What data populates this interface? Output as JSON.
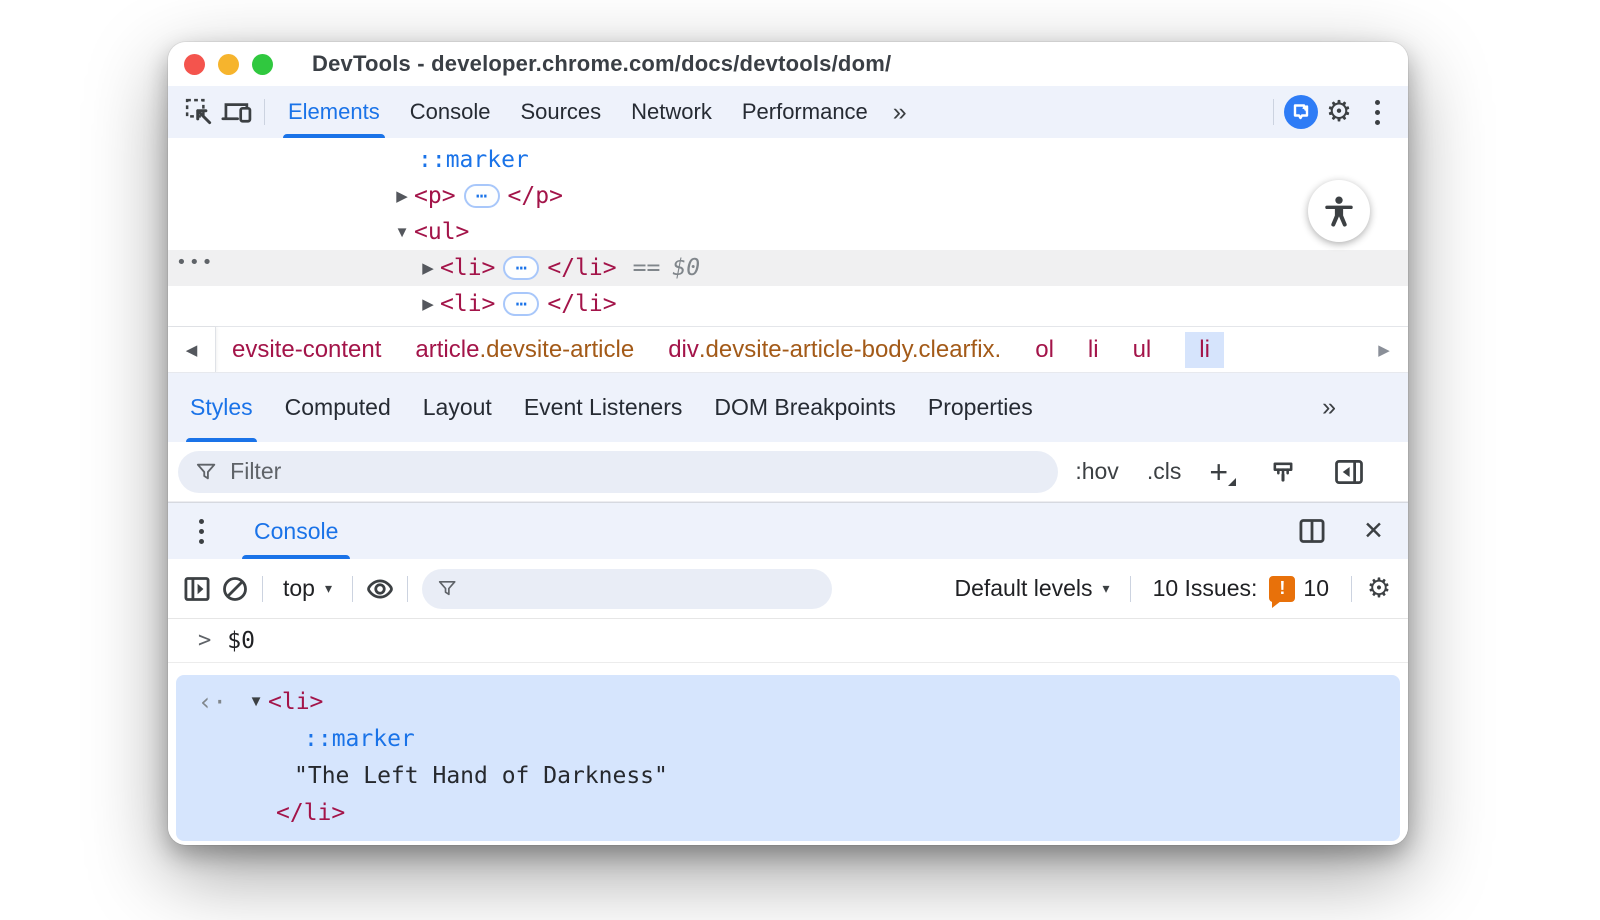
{
  "colors": {
    "accent": "#1a73e8",
    "tag": "#a31449",
    "cls": "#a35a18",
    "issues": "#e8710a",
    "selection": "#d6e5fd",
    "crumb_sel": "#d6e4fc",
    "toolbar_bg": "#eef2fb",
    "ai_blue": "#2e7cf6",
    "traffic_red": "#f4544d",
    "traffic_yellow": "#f6b42d",
    "traffic_green": "#30c83f"
  },
  "window": {
    "title": "DevTools - developer.chrome.com/docs/devtools/dom/"
  },
  "main_tabs": {
    "elements": "Elements",
    "console": "Console",
    "sources": "Sources",
    "network": "Network",
    "performance": "Performance",
    "more": "»"
  },
  "tree": {
    "gutter_dots": "•••",
    "marker": "::marker",
    "p_open": "<p>",
    "p_close": "</p>",
    "ul_open": "<ul>",
    "li_open": "<li>",
    "li_close": "</li>",
    "ellipsis": "⋯",
    "eq": "==",
    "stored_ref": "$0",
    "arrow_right": "▶",
    "arrow_down": "▼"
  },
  "breadcrumb": {
    "back": "◀",
    "forward": "▶",
    "items": [
      {
        "tag": "evsite-content",
        "cls": ""
      },
      {
        "tag": "article",
        "cls": ".devsite-article"
      },
      {
        "tag": "div",
        "cls": ".devsite-article-body.clearfix."
      },
      {
        "tag": "ol",
        "cls": ""
      },
      {
        "tag": "li",
        "cls": ""
      },
      {
        "tag": "ul",
        "cls": ""
      },
      {
        "tag": "li",
        "cls": ""
      }
    ]
  },
  "styles_tabs": {
    "styles": "Styles",
    "computed": "Computed",
    "layout": "Layout",
    "event_listeners": "Event Listeners",
    "dom_breakpoints": "DOM Breakpoints",
    "properties": "Properties",
    "more": "»"
  },
  "styles_bar": {
    "filter_placeholder": "Filter",
    "hov": ":hov",
    "cls": ".cls",
    "plus": "+"
  },
  "drawer": {
    "tab": "Console",
    "close": "✕"
  },
  "console_toolbar": {
    "context": "top",
    "levels": "Default levels",
    "issues_label": "10 Issues:",
    "issues_badge": "!",
    "issues_count": "10",
    "caret": "▾"
  },
  "console": {
    "prompt": ">",
    "command": "$0",
    "result_arrow": "‹·",
    "node_arrow": "▼",
    "li_open": "<li>",
    "marker": "::marker",
    "text": "\"The Left Hand of Darkness\"",
    "li_close": "</li>"
  }
}
